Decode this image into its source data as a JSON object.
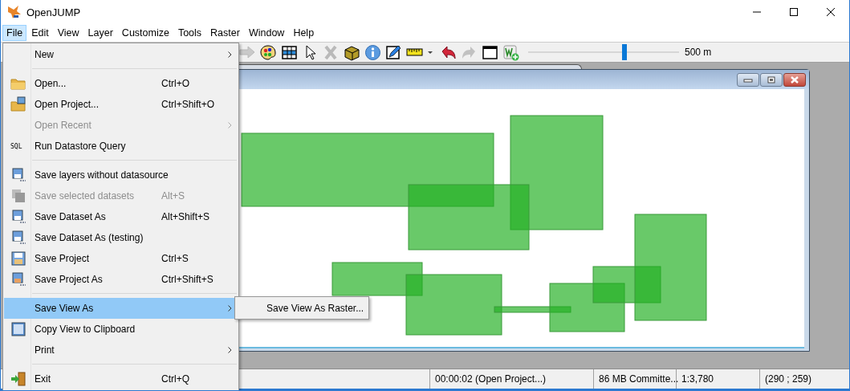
{
  "window": {
    "title": "OpenJUMP"
  },
  "menubar": [
    {
      "label": "File",
      "selected": true
    },
    {
      "label": "Edit",
      "selected": false
    },
    {
      "label": "View",
      "selected": false
    },
    {
      "label": "Layer",
      "selected": false
    },
    {
      "label": "Customize",
      "selected": false
    },
    {
      "label": "Tools",
      "selected": false
    },
    {
      "label": "Raster",
      "selected": false
    },
    {
      "label": "Window",
      "selected": false
    },
    {
      "label": "Help",
      "selected": false
    }
  ],
  "toolbar": {
    "buttons": [
      {
        "disabled": true
      },
      {
        "disabled": false
      },
      {
        "disabled": false
      },
      {
        "disabled": false
      },
      {
        "disabled": true
      },
      {
        "disabled": false
      },
      {
        "disabled": false
      },
      {
        "disabled": false
      },
      {
        "disabled": false
      },
      {
        "disabled": false
      },
      {
        "disabled": true
      },
      {
        "disabled": false
      },
      {
        "disabled": false
      }
    ],
    "scale_slider": {
      "level": 0.64,
      "reading": "500 m"
    }
  },
  "file_menu": {
    "items": [
      {
        "kind": "item",
        "label": "New",
        "submenu": true,
        "disabled": false,
        "selected": false
      },
      {
        "kind": "separator"
      },
      {
        "kind": "item",
        "label": "Open...",
        "shortcut": "Ctrl+O",
        "submenu": false,
        "disabled": false,
        "selected": false
      },
      {
        "kind": "item",
        "label": "Open Project...",
        "shortcut": "Ctrl+Shift+O",
        "submenu": false,
        "disabled": false,
        "selected": false
      },
      {
        "kind": "item",
        "label": "Open Recent",
        "submenu": true,
        "disabled": true,
        "selected": false
      },
      {
        "kind": "item",
        "label": "Run Datastore Query",
        "badge": "SQL",
        "submenu": false,
        "disabled": false,
        "selected": false
      },
      {
        "kind": "separator"
      },
      {
        "kind": "item",
        "label": "Save layers without datasource",
        "submenu": false,
        "disabled": false,
        "selected": false
      },
      {
        "kind": "item",
        "label": "Save selected datasets",
        "shortcut": "Alt+S",
        "submenu": false,
        "disabled": true,
        "selected": false
      },
      {
        "kind": "item",
        "label": "Save Dataset As",
        "shortcut": "Alt+Shift+S",
        "submenu": false,
        "disabled": false,
        "selected": false
      },
      {
        "kind": "item",
        "label": "Save Dataset As (testing)",
        "submenu": false,
        "disabled": false,
        "selected": false
      },
      {
        "kind": "item",
        "label": "Save Project",
        "shortcut": "Ctrl+S",
        "submenu": false,
        "disabled": false,
        "selected": false
      },
      {
        "kind": "item",
        "label": "Save Project As",
        "shortcut": "Ctrl+Shift+S",
        "submenu": false,
        "disabled": false,
        "selected": false
      },
      {
        "kind": "separator"
      },
      {
        "kind": "item",
        "label": "Save View As",
        "submenu": true,
        "disabled": false,
        "selected": true
      },
      {
        "kind": "item",
        "label": "Copy View to Clipboard",
        "submenu": false,
        "disabled": false,
        "selected": false
      },
      {
        "kind": "item",
        "label": "Print",
        "submenu": true,
        "disabled": false,
        "selected": false
      },
      {
        "kind": "separator"
      },
      {
        "kind": "item",
        "label": "Exit",
        "shortcut": "Ctrl+Q",
        "submenu": false,
        "disabled": false,
        "selected": false
      }
    ]
  },
  "submenu": {
    "items": [
      {
        "label": "Save View As Raster..."
      }
    ]
  },
  "status_bar": {
    "cells": [
      "00:00:02 (Open Project...)",
      "86 MB Committe...",
      "1:3,780",
      "(290 ; 259)"
    ]
  }
}
